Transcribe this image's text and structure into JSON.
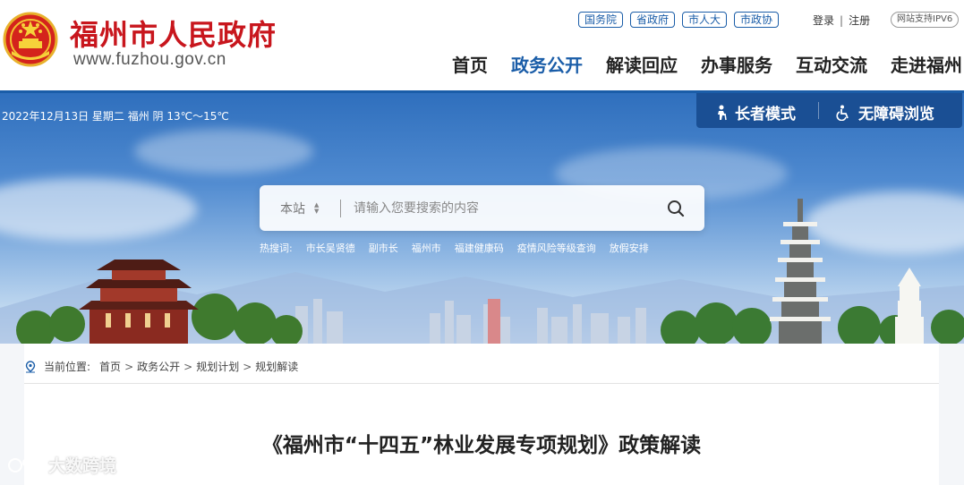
{
  "header": {
    "site_name": "福州市人民政府",
    "site_url": "www.fuzhou.gov.cn",
    "gov_links": [
      "国务院",
      "省政府",
      "市人大",
      "市政协"
    ],
    "login": "登录",
    "auth_sep": "|",
    "register": "注册",
    "ipv6": "网站支持IPV6",
    "nav": [
      {
        "label": "首页",
        "active": false
      },
      {
        "label": "政务公开",
        "active": true
      },
      {
        "label": "解读回应",
        "active": false
      },
      {
        "label": "办事服务",
        "active": false
      },
      {
        "label": "互动交流",
        "active": false
      },
      {
        "label": "走进福州",
        "active": false
      }
    ]
  },
  "banner": {
    "date_info": "2022年12月13日 星期二 福州 阴 13℃～15℃",
    "elder_mode": "长者模式",
    "barrier_free": "无障碍浏览",
    "search": {
      "scope": "本站",
      "placeholder": "请输入您要搜索的内容",
      "icon": "search-icon"
    },
    "hot_label": "热搜词:",
    "hot_words": [
      "市长吴贤德",
      "副市长",
      "福州市",
      "福建健康码",
      "疫情风险等级查询",
      "放假安排"
    ]
  },
  "breadcrumb": {
    "label": "当前位置:",
    "items": [
      "首页",
      "政务公开",
      "规划计划",
      "规划解读"
    ],
    "separator": ">"
  },
  "article": {
    "title": "《福州市“十四五”林业发展专项规划》政策解读"
  },
  "watermark": "大数跨境",
  "colors": {
    "brand_red": "#c8161d",
    "brand_blue": "#1a5da8",
    "access_bar": "#1a4f94"
  }
}
